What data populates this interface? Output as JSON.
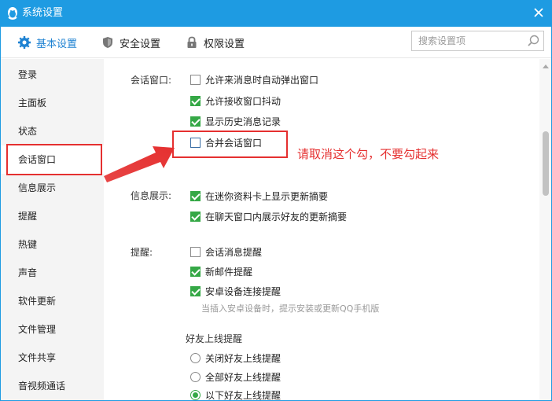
{
  "window": {
    "title": "系统设置"
  },
  "tabs": [
    {
      "label": "基本设置",
      "icon": "gear-icon",
      "active": true
    },
    {
      "label": "安全设置",
      "icon": "shield-icon",
      "active": false
    },
    {
      "label": "权限设置",
      "icon": "lock-icon",
      "active": false
    }
  ],
  "search": {
    "placeholder": "搜索设置项"
  },
  "sidebar": {
    "items": [
      {
        "label": "登录"
      },
      {
        "label": "主面板"
      },
      {
        "label": "状态"
      },
      {
        "label": "会话窗口",
        "active": true
      },
      {
        "label": "信息展示"
      },
      {
        "label": "提醒"
      },
      {
        "label": "热键"
      },
      {
        "label": "声音"
      },
      {
        "label": "软件更新"
      },
      {
        "label": "文件管理"
      },
      {
        "label": "文件共享"
      },
      {
        "label": "音视频通话"
      }
    ]
  },
  "sections": {
    "chat_window": {
      "label": "会话窗口:",
      "options": [
        {
          "label": "允许来消息时自动弹出窗口",
          "checked": false
        },
        {
          "label": "允许接收窗口抖动",
          "checked": true
        },
        {
          "label": "显示历史消息记录",
          "checked": true
        },
        {
          "label": "合并会话窗口",
          "checked": false
        }
      ]
    },
    "info_display": {
      "label": "信息展示:",
      "options": [
        {
          "label": "在迷你资料卡上显示更新摘要",
          "checked": true
        },
        {
          "label": "在聊天窗口内展示好友的更新摘要",
          "checked": true
        }
      ]
    },
    "reminder": {
      "label": "提醒:",
      "options": [
        {
          "label": "会话消息提醒",
          "checked": false
        },
        {
          "label": "新邮件提醒",
          "checked": true
        },
        {
          "label": "安卓设备连接提醒",
          "checked": true
        }
      ],
      "hint": "当插入安卓设备时，提示安装或更新QQ手机版",
      "friend_online": {
        "heading": "好友上线提醒",
        "radios": [
          {
            "label": "关闭好友上线提醒",
            "checked": false
          },
          {
            "label": "全部好友上线提醒",
            "checked": false
          },
          {
            "label": "以下好友上线提醒",
            "checked": true
          }
        ]
      }
    }
  },
  "annotation": {
    "text": "请取消这个勾，不要勾起来"
  },
  "colors": {
    "accent": "#1e9be2",
    "check": "#35a846",
    "annotation": "#e53030"
  }
}
